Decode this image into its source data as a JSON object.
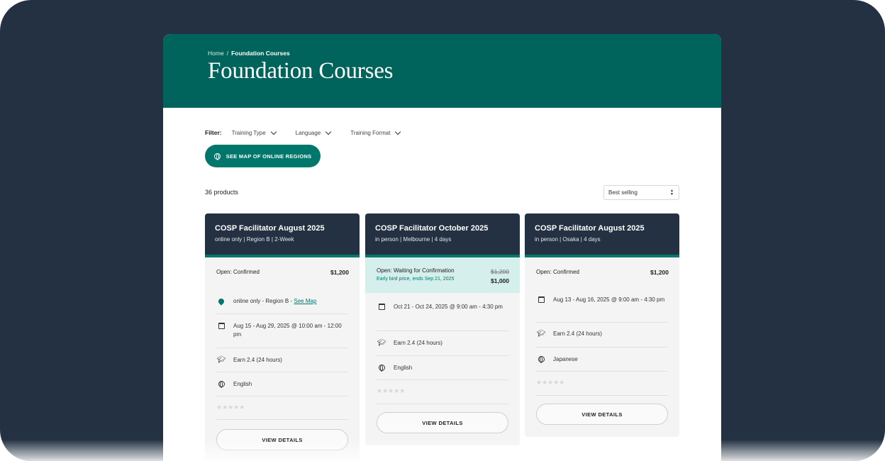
{
  "breadcrumb": {
    "home": "Home",
    "separator": "/",
    "current": "Foundation Courses"
  },
  "page_title": "Foundation Courses",
  "filter": {
    "label": "Filter:",
    "options": [
      {
        "label": "Training Type",
        "icon": "chevron-down-icon"
      },
      {
        "label": "Language",
        "icon": "chevron-down-icon"
      },
      {
        "label": "Training Format",
        "icon": "chevron-down-icon"
      }
    ]
  },
  "map_button": {
    "label": "SEE MAP OF ONLINE REGIONS",
    "icon": "globe-icon"
  },
  "product_count": "36 products",
  "sort": {
    "selected": "Best selling"
  },
  "colors": {
    "header_bg": "#01645c",
    "accent": "#01776c",
    "card_header": "#233142",
    "highlight": "#d5efec"
  },
  "cards": [
    {
      "title": "COSP Facilitator August 2025",
      "subtitle": "online only | Region B | 2-Week",
      "status": "Open: Confirmed",
      "price": "$1,200",
      "location": "online only - Region B - ",
      "location_link": "See Map",
      "dates": "Aug 15 - Aug 29, 2025 @ 10:00 am - 12:00 pm",
      "credits": "Earn 2.4 (24 hours)",
      "language": "English",
      "stars": "★★★★★",
      "button": "VIEW DETAILS"
    },
    {
      "title": "COSP Facilitator October 2025",
      "subtitle": "in person | Melbourne | 4 days",
      "status": "Open: Waiting for Confirmation",
      "old_price": "$1,200",
      "price": "$1,000",
      "note": "Early bird price, ends Sep 21, 2025",
      "dates": "Oct 21 - Oct 24, 2025 @ 9:00 am - 4:30 pm",
      "credits": "Earn 2.4 (24 hours)",
      "language": "English",
      "stars": "★★★★★",
      "button": "VIEW DETAILS"
    },
    {
      "title": "COSP Facilitator August 2025",
      "subtitle": "in person | Osaka | 4 days",
      "status": "Open: Confirmed",
      "price": "$1,200",
      "dates": "Aug 13 - Aug 16, 2025 @ 9:00 am - 4:30 pm",
      "credits": "Earn 2.4 (24 hours)",
      "language": "Japanese",
      "stars": "★★★★★",
      "button": "VIEW DETAILS"
    }
  ]
}
